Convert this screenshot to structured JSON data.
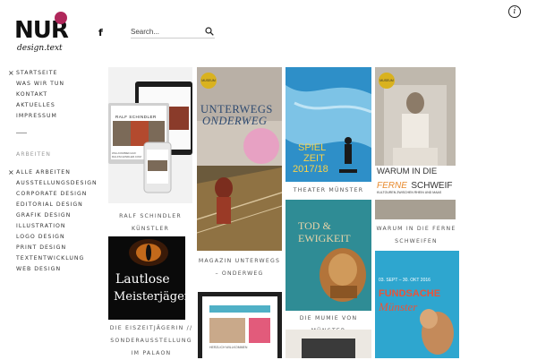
{
  "brand": {
    "name": "NUR",
    "tagline": "design.text"
  },
  "header": {
    "facebook_icon": "facebook-icon",
    "search_placeholder": "Search...",
    "search_icon": "search-icon",
    "info_icon": "info-icon"
  },
  "nav": {
    "main": [
      "STARTSEITE",
      "WAS WIR TUN",
      "KONTAKT",
      "AKTUELLES",
      "IMPRESSUM"
    ],
    "active_main": "STARTSEITE",
    "section_title": "ARBEITEN",
    "categories": [
      "ALLE ARBEITEN",
      "AUSSTELLUNGSDESIGN",
      "CORPORATE DESIGN",
      "EDITORIAL DESIGN",
      "GRAFIK DESIGN",
      "ILLUSTRATION",
      "LOGO DESIGN",
      "PRINT DESIGN",
      "TEXTENTWICKLUNG",
      "WEB DESIGN"
    ],
    "active_category": "ALLE ARBEITEN"
  },
  "portfolio": {
    "ralf": {
      "caption": "RALF SCHINDLER KÜNSTLER",
      "screen_title": "RALF SCHINDLER",
      "screen_heading": "WILLKOMMEN AUF RALFSCHINDLER.COM"
    },
    "unterwegs": {
      "caption": "MAGAZIN UNTERWEGS – ONDERWEG",
      "badge": "MUSEUM",
      "title_line1": "UNTERWEGS",
      "title_line2": "ONDERWEG"
    },
    "theater": {
      "caption": "THEATER MÜNSTER",
      "season_line1": "SPIEL",
      "season_line2": "ZEIT",
      "season_line3": "2017/18"
    },
    "ferne": {
      "caption": "WARUM IN DIE FERNE SCHWEIFEN",
      "badge": "MUSEUM",
      "title_line1": "WARUM IN DIE",
      "title_word_accent": "FERNE",
      "title_word_end": "SCHWEIF",
      "subtitle": "KULTOUREN ZWISCHEN RHEIN UND MAAS"
    },
    "eiszeit": {
      "caption": "DIE EISZEITJÄGERIN // SONDERAUSSTELLUNG IM PALAON",
      "title_line1": "Lautlose",
      "title_line2": "Meisterjäger"
    },
    "mumie": {
      "caption": "DIE MUMIE VON MÜNSTER",
      "title_line1": "TOD &",
      "title_line2": "EWIGKEIT"
    },
    "fundsache": {
      "dates": "03. SEPT – 30. OKT 2016",
      "title_line1": "FUNDSACHE",
      "title_line2": "Münster"
    },
    "willkommen": {
      "heading": "HERZLICH WILLKOMMEN"
    }
  },
  "colors": {
    "brand_accent": "#b0275b",
    "fundsache_bg": "#2ea6cf",
    "fundsache_title": "#e8543a",
    "theater_bg": "#2e8fc8",
    "mumie_bg": "#2f8c95"
  }
}
